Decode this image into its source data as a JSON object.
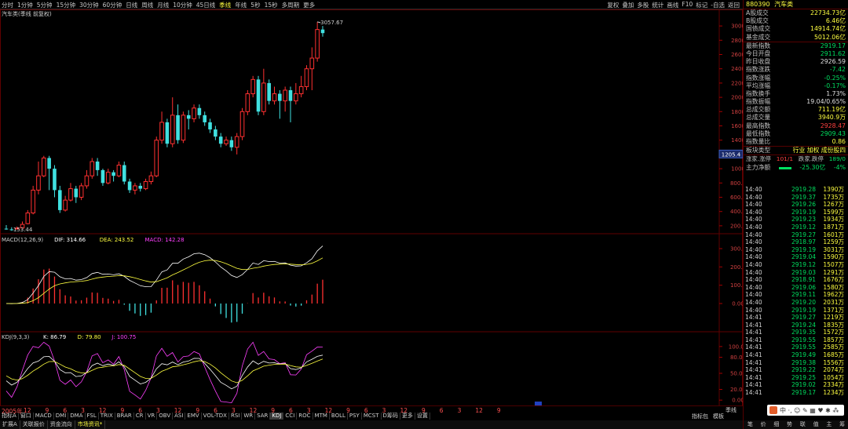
{
  "toolbar": {
    "periods": [
      "分时",
      "1分钟",
      "5分钟",
      "15分钟",
      "30分钟",
      "60分钟",
      "日线",
      "周线",
      "月线",
      "10分钟",
      "45日线",
      "季线",
      "年线",
      "5秒",
      "15秒",
      "多周期",
      "更多"
    ],
    "active_period": "季线",
    "tools": [
      "叠加",
      "多股",
      "统计",
      "画线",
      "F10",
      "标记",
      "-自选",
      "返回"
    ],
    "tools_first": "复权"
  },
  "chart_header": {
    "title": "汽车类(季线 前复权)",
    "high_label": "3057.67",
    "low_label": "153.44",
    "price_axis": [
      "3000",
      "2800",
      "2600",
      "2400",
      "2200",
      "2000",
      "1800",
      "1600",
      "1400",
      "1200",
      "1000",
      "800.0",
      "600.0",
      "400.0",
      "200.0"
    ],
    "current_price_tag": "1205.4"
  },
  "macd": {
    "name": "MACD(12,26,9)",
    "dif": "DIF: 314.66",
    "dea": "DEA: 243.52",
    "macd": "MACD: 142.28",
    "axis": [
      "300.0",
      "200.0",
      "100.0",
      "0.00"
    ]
  },
  "kdj": {
    "name": "KDJ(9,3,3)",
    "k": "K: 86.79",
    "d": "D: 79.80",
    "j": "J: 100.75",
    "axis": [
      "100.00",
      "80.00",
      "50.00",
      "20.00",
      "0.00"
    ]
  },
  "indicator_bar": {
    "year": "2005年",
    "marks": [
      "12",
      "9",
      "6",
      "3",
      "12",
      "9",
      "6",
      "3",
      "12",
      "9",
      "6",
      "3",
      "12",
      "9",
      "6",
      "3",
      "12",
      "9",
      "6",
      "3",
      "12",
      "9",
      "6",
      "3",
      "12",
      "9"
    ],
    "tabs": [
      "指标A",
      "窗口",
      "MACD",
      "DMI",
      "DMA",
      "FSL",
      "TRIX",
      "BRAR",
      "CR",
      "VR",
      "OBV",
      "ASI",
      "EMV",
      "VOL-TDX",
      "RSI",
      "WR",
      "SAR",
      "KDJ",
      "CCI",
      "ROC",
      "MTM",
      "BOLL",
      "PSY",
      "MCST",
      "D筹码",
      "更多",
      "设置"
    ],
    "active_tab": "KDJ",
    "right_tabs": [
      "指标包",
      "模板"
    ],
    "period_word": "季线"
  },
  "bottom_bar": {
    "items": [
      "扩展A",
      "关联报价",
      "资金流向",
      "市场资讯*"
    ],
    "highlight": "市场资讯*"
  },
  "side_panel": {
    "code": "880390",
    "name": "汽车类",
    "stats_a": [
      {
        "label": "A股成交",
        "value": "22734.73亿",
        "color": "#ffff40"
      },
      {
        "label": "B股成交",
        "value": "6.46亿",
        "color": "#ffff40"
      },
      {
        "label": "国债成交",
        "value": "14914.74亿",
        "color": "#ffff40"
      },
      {
        "label": "基金成交",
        "value": "5012.06亿",
        "color": "#ffff40"
      }
    ],
    "stats_b": [
      {
        "label": "最新指数",
        "value": "2919.17",
        "color": "#00e060"
      },
      {
        "label": "今日开盘",
        "value": "2911.62",
        "color": "#00e060"
      },
      {
        "label": "昨日收盘",
        "value": "2926.59",
        "color": "#e0e0e0"
      },
      {
        "label": "指数涨跌",
        "value": "-7.42",
        "color": "#00e060"
      },
      {
        "label": "指数涨幅",
        "value": "-0.25%",
        "color": "#00e060"
      },
      {
        "label": "平均涨幅",
        "value": "-0.17%",
        "color": "#00e060"
      },
      {
        "label": "指数换手",
        "value": "1.73%",
        "color": "#e0e0e0"
      },
      {
        "label": "指数振幅",
        "value": "19.04/0.65%",
        "color": "#e0e0e0"
      },
      {
        "label": "总成交额",
        "value": "711.19亿",
        "color": "#ffff40"
      },
      {
        "label": "总成交量",
        "value": "3940.9万",
        "color": "#ffff40"
      },
      {
        "label": "最高指数",
        "value": "2928.47",
        "color": "#ff4040"
      },
      {
        "label": "最低指数",
        "value": "2909.43",
        "color": "#00e060"
      },
      {
        "label": "指数量比",
        "value": "0.86",
        "color": "#ffff40"
      }
    ],
    "board_type": {
      "label": "板块类型",
      "value": "行业 加权 成份股四",
      "color": "#ffff40"
    },
    "updown": {
      "label1": "涨家.涨停",
      "val1": "101/1",
      "label2": "跌家.跌停",
      "val2": "189/0"
    },
    "flow": {
      "label": "主力净额",
      "value": "-25.30亿",
      "pct": "-4%"
    },
    "ticks": [
      {
        "t": "14:40",
        "p": "2919.28",
        "v": "1390万"
      },
      {
        "t": "14:40",
        "p": "2919.37",
        "v": "1735万"
      },
      {
        "t": "14:40",
        "p": "2919.26",
        "v": "1267万"
      },
      {
        "t": "14:40",
        "p": "2919.19",
        "v": "1599万"
      },
      {
        "t": "14:40",
        "p": "2919.23",
        "v": "1934万"
      },
      {
        "t": "14:40",
        "p": "2919.12",
        "v": "1871万"
      },
      {
        "t": "14:40",
        "p": "2919.27",
        "v": "1601万"
      },
      {
        "t": "14:40",
        "p": "2918.97",
        "v": "1259万"
      },
      {
        "t": "14:40",
        "p": "2919.19",
        "v": "3031万"
      },
      {
        "t": "14:40",
        "p": "2919.04",
        "v": "1590万"
      },
      {
        "t": "14:40",
        "p": "2919.12",
        "v": "1507万"
      },
      {
        "t": "14:40",
        "p": "2919.03",
        "v": "1291万"
      },
      {
        "t": "14:40",
        "p": "2918.91",
        "v": "1676万"
      },
      {
        "t": "14:40",
        "p": "2919.06",
        "v": "1580万"
      },
      {
        "t": "14:40",
        "p": "2919.11",
        "v": "1962万"
      },
      {
        "t": "14:40",
        "p": "2919.20",
        "v": "2031万"
      },
      {
        "t": "14:40",
        "p": "2919.19",
        "v": "1371万"
      },
      {
        "t": "14:41",
        "p": "2919.27",
        "v": "1219万"
      },
      {
        "t": "14:41",
        "p": "2919.24",
        "v": "1835万"
      },
      {
        "t": "14:41",
        "p": "2919.35",
        "v": "1572万"
      },
      {
        "t": "14:41",
        "p": "2919.55",
        "v": "1857万"
      },
      {
        "t": "14:41",
        "p": "2919.55",
        "v": "2585万"
      },
      {
        "t": "14:41",
        "p": "2919.49",
        "v": "1685万"
      },
      {
        "t": "14:41",
        "p": "2919.38",
        "v": "1556万"
      },
      {
        "t": "14:41",
        "p": "2919.22",
        "v": "2074万"
      },
      {
        "t": "14:41",
        "p": "2919.25",
        "v": "1054万"
      },
      {
        "t": "14:41",
        "p": "2919.02",
        "v": "2334万"
      },
      {
        "t": "14:41",
        "p": "2919.17",
        "v": "1234万"
      }
    ],
    "bottom": [
      "笔",
      "价",
      "细",
      "势",
      "联",
      "值",
      "主",
      "筹"
    ]
  },
  "colors": {
    "up": "#ff3030",
    "down": "#40e0e0",
    "frame": "#600000",
    "dif": "#ffffff",
    "dea": "#ffff40",
    "j": "#ff40ff"
  },
  "candles": [
    [
      160,
      150,
      210,
      145
    ],
    [
      150,
      140,
      180,
      130
    ],
    [
      155,
      165,
      190,
      150
    ],
    [
      170,
      220,
      260,
      165
    ],
    [
      230,
      380,
      420,
      220
    ],
    [
      380,
      700,
      760,
      360
    ],
    [
      700,
      900,
      1100,
      640
    ],
    [
      900,
      1150,
      1180,
      880
    ],
    [
      1150,
      1000,
      1180,
      700
    ],
    [
      1000,
      700,
      1050,
      600
    ],
    [
      700,
      420,
      760,
      380
    ],
    [
      420,
      560,
      620,
      400
    ],
    [
      560,
      720,
      800,
      540
    ],
    [
      720,
      600,
      760,
      520
    ],
    [
      600,
      760,
      800,
      560
    ],
    [
      760,
      900,
      980,
      720
    ],
    [
      900,
      1100,
      1150,
      860
    ],
    [
      1100,
      980,
      1150,
      900
    ],
    [
      980,
      800,
      1000,
      760
    ],
    [
      800,
      950,
      1000,
      780
    ],
    [
      950,
      900,
      980,
      820
    ],
    [
      900,
      1050,
      1100,
      880
    ],
    [
      1050,
      820,
      1100,
      780
    ],
    [
      820,
      700,
      860,
      660
    ],
    [
      700,
      760,
      800,
      640
    ],
    [
      760,
      720,
      800,
      680
    ],
    [
      720,
      820,
      860,
      700
    ],
    [
      820,
      900,
      960,
      780
    ],
    [
      900,
      1400,
      1450,
      880
    ],
    [
      1400,
      1650,
      1800,
      1350
    ],
    [
      1650,
      1350,
      1700,
      1300
    ],
    [
      1350,
      1750,
      2000,
      1300
    ],
    [
      1750,
      1400,
      1900,
      1350
    ],
    [
      1400,
      1750,
      1800,
      1360
    ],
    [
      1750,
      1700,
      1820,
      1550
    ],
    [
      1700,
      1850,
      1900,
      1650
    ],
    [
      1850,
      1750,
      1900,
      1700
    ],
    [
      1750,
      1650,
      1800,
      1600
    ],
    [
      1650,
      1550,
      1700,
      1500
    ],
    [
      1550,
      1450,
      1600,
      1400
    ],
    [
      1450,
      1350,
      1500,
      1300
    ],
    [
      1350,
      1400,
      1450,
      1320
    ],
    [
      1400,
      1300,
      1450,
      1250
    ],
    [
      1300,
      1450,
      1500,
      1200
    ],
    [
      1450,
      1800,
      1850,
      1400
    ],
    [
      1800,
      2050,
      2100,
      1750
    ],
    [
      2050,
      2250,
      2300,
      2000
    ],
    [
      2250,
      1800,
      2300,
      1750
    ],
    [
      1800,
      2200,
      2400,
      1750
    ],
    [
      2200,
      1950,
      2250,
      1900
    ],
    [
      1950,
      2050,
      2150,
      1900
    ],
    [
      2050,
      1950,
      2100,
      1700
    ],
    [
      1950,
      2100,
      2150,
      1800
    ],
    [
      2100,
      1950,
      2150,
      1650
    ],
    [
      1950,
      2050,
      2200,
      1900
    ],
    [
      2050,
      2150,
      2300,
      2000
    ],
    [
      2150,
      2400,
      2450,
      2100
    ],
    [
      2400,
      2550,
      2700,
      2100
    ],
    [
      2550,
      2950,
      3057,
      2500
    ],
    [
      2950,
      2900,
      3000,
      2850
    ]
  ]
}
